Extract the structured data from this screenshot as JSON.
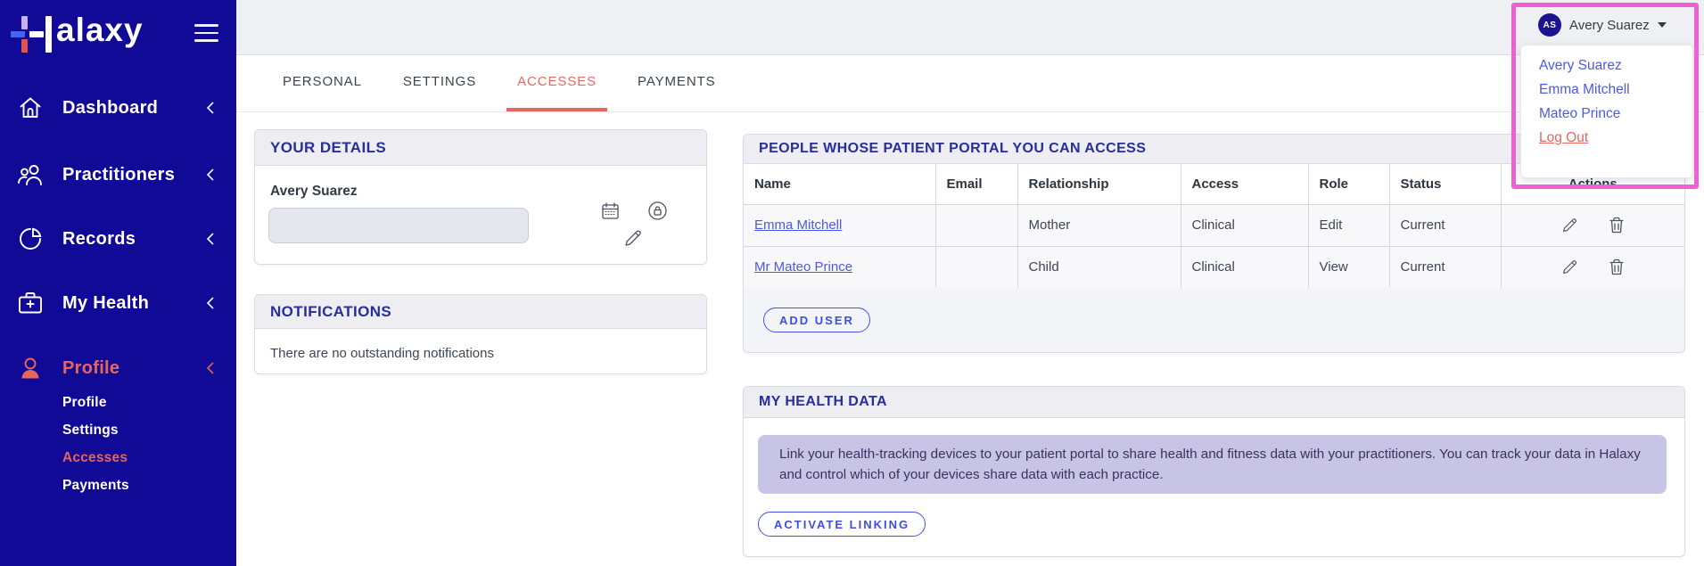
{
  "brand": {
    "logo_text": "alaxy"
  },
  "colors": {
    "sidebar_bg": "#110a97",
    "accent_coral": "#e8655c",
    "link_blue": "#4a5ae8",
    "card_title_navy": "#272e9b",
    "notice_lavender": "#c8c4e6",
    "annotation_pink": "#f05fd5",
    "avatar_bg": "#1c1390"
  },
  "sidebar": {
    "items": [
      {
        "label": "Dashboard"
      },
      {
        "label": "Practitioners"
      },
      {
        "label": "Records"
      },
      {
        "label": "My Health"
      },
      {
        "label": "Profile"
      }
    ],
    "sub_items": [
      {
        "label": "Profile"
      },
      {
        "label": "Settings"
      },
      {
        "label": "Accesses"
      },
      {
        "label": "Payments"
      }
    ]
  },
  "tabs": [
    {
      "label": "PERSONAL"
    },
    {
      "label": "SETTINGS"
    },
    {
      "label": "ACCESSES"
    },
    {
      "label": "PAYMENTS"
    }
  ],
  "header": {
    "user": {
      "initials": "AS",
      "name": "Avery Suarez"
    },
    "menu": {
      "items": [
        {
          "label": "Avery Suarez"
        },
        {
          "label": "Emma Mitchell"
        },
        {
          "label": "Mateo Prince"
        }
      ],
      "logout_label": "Log Out"
    }
  },
  "your_details": {
    "title": "YOUR DETAILS",
    "name": "Avery Suarez",
    "field_value": ""
  },
  "notifications": {
    "title": "NOTIFICATIONS",
    "message": "There are no outstanding notifications"
  },
  "access_table": {
    "title": "PEOPLE WHOSE PATIENT PORTAL YOU CAN ACCESS",
    "columns": [
      "Name",
      "Email",
      "Relationship",
      "Access",
      "Role",
      "Status",
      "Actions"
    ],
    "rows": [
      {
        "name": "Emma Mitchell",
        "email": "",
        "relationship": "Mother",
        "access": "Clinical",
        "role": "Edit",
        "status": "Current"
      },
      {
        "name": "Mr Mateo Prince",
        "email": "",
        "relationship": "Child",
        "access": "Clinical",
        "role": "View",
        "status": "Current"
      }
    ],
    "add_user_label": "ADD USER"
  },
  "my_health_data": {
    "title": "MY HEALTH DATA",
    "notice": "Link your health-tracking devices to your patient portal to share health and fitness data with your practitioners. You can track your data in Halaxy and control which of your devices share data with each practice.",
    "activate_label": "ACTIVATE LINKING"
  }
}
